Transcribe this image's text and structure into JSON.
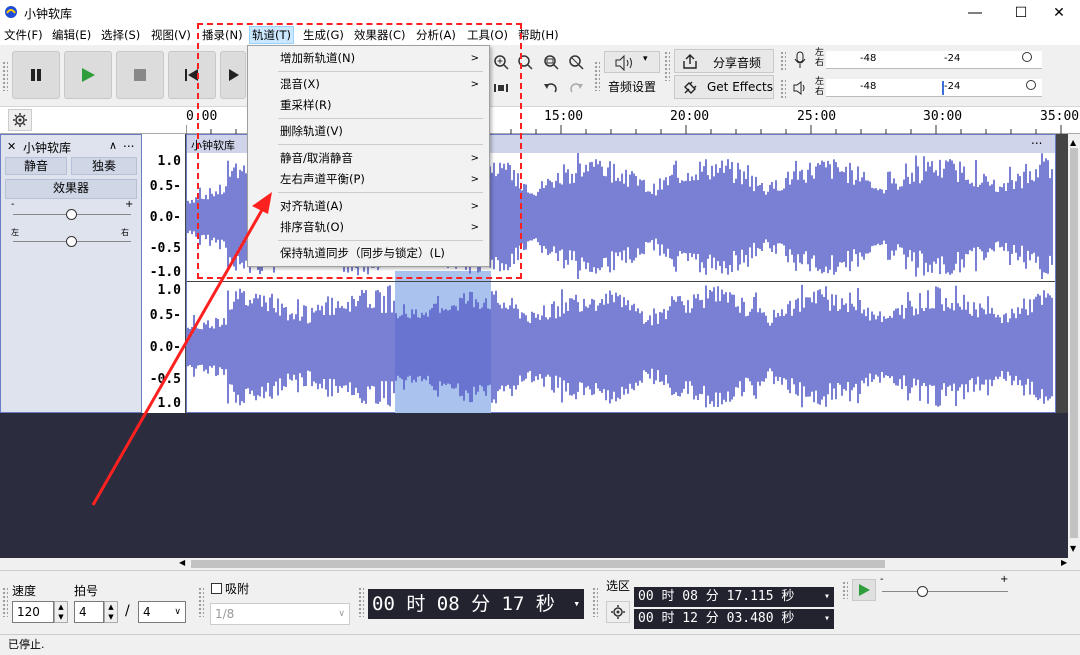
{
  "window": {
    "title": "小钟软库"
  },
  "menu": [
    "文件(F)",
    "编辑(E)",
    "选择(S)",
    "视图(V)",
    "播录(N)",
    "轨道(T)",
    "生成(G)",
    "效果器(C)",
    "分析(A)",
    "工具(O)",
    "帮助(H)"
  ],
  "toolbar": {
    "audio_setup": "音频设置",
    "share_audio": "分享音频",
    "get_effects": "Get Effects"
  },
  "meters": {
    "rec_lr": [
      "左",
      "右"
    ],
    "play_lr": [
      "左",
      "右"
    ],
    "ticks": [
      "-48",
      "-24",
      "0"
    ]
  },
  "ruler": [
    "0:00",
    "15:00",
    "20:00",
    "25:00",
    "30:00",
    "35:00"
  ],
  "track": {
    "name": "小钟软库",
    "clip_name": "小钟软库",
    "mute": "静音",
    "solo": "独奏",
    "effects": "效果器",
    "gain_minus": "-",
    "gain_plus": "+",
    "pan_left": "左",
    "pan_right": "右",
    "more": "...",
    "collapse": "∧"
  },
  "vscale": {
    "ch1": [
      "1.0",
      "0.5-",
      "0.0-",
      "-0.5",
      "-1.0"
    ],
    "ch2": [
      "1.0",
      "0.5-",
      "0.0-",
      "-0.5",
      "1.0"
    ]
  },
  "dropdown": {
    "items": [
      {
        "label": "增加新轨道(N)",
        "arrow": true
      },
      {
        "label": "混音(X)",
        "arrow": true
      },
      {
        "label": "重采样(R)",
        "arrow": false
      },
      {
        "label": "删除轨道(V)",
        "arrow": false
      },
      {
        "label": "静音/取消静音",
        "arrow": true
      },
      {
        "label": "左右声道平衡(P)",
        "arrow": true
      },
      {
        "label": "对齐轨道(A)",
        "arrow": true
      },
      {
        "label": "排序音轨(O)",
        "arrow": true
      },
      {
        "label": "保持轨道同步（同步与锁定）(L)",
        "arrow": false
      }
    ]
  },
  "bottom": {
    "speed_label": "速度",
    "speed_value": "120",
    "beat_label": "拍号",
    "beat_num": "4",
    "beat_slash": "/",
    "beat_den": "4",
    "snap_label": "吸附",
    "snap_value": "1/8",
    "time_display": "00 时 08 分 17 秒",
    "selection_label": "选区",
    "sel_start": "00 时 08 分 17.115 秒",
    "sel_end": "00 时 12 分 03.480 秒",
    "play_minus": "-",
    "play_plus": "+"
  },
  "status": "已停止.",
  "colors": {
    "wave": "#5860c9",
    "selection": "#a9c3ee",
    "annotation": "#ff1f1f"
  }
}
